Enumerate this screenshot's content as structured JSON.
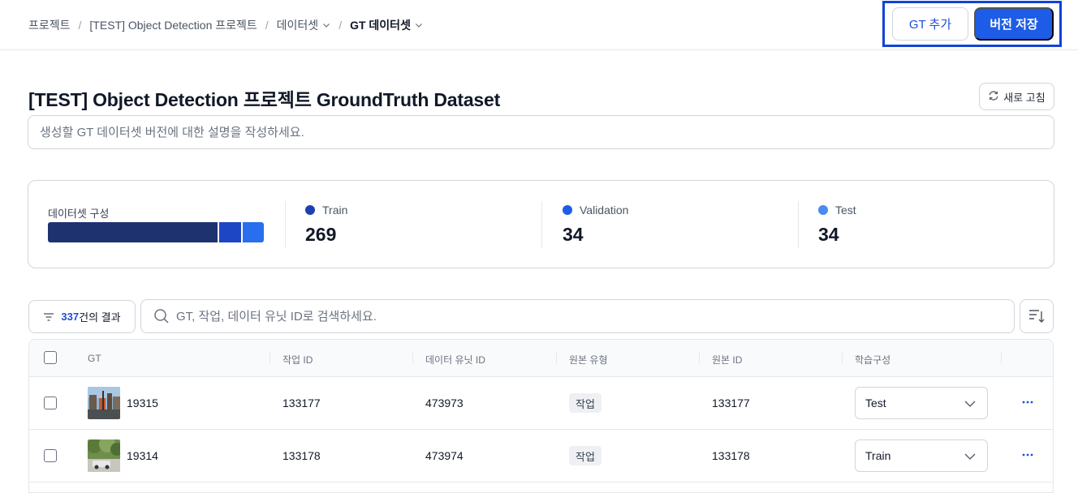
{
  "breadcrumb": {
    "items": [
      {
        "label": "프로젝트",
        "dropdown": false
      },
      {
        "label": "[TEST] Object Detection 프로젝트",
        "dropdown": false
      },
      {
        "label": "데이터셋",
        "dropdown": true
      },
      {
        "label": "GT 데이터셋",
        "dropdown": true
      }
    ],
    "separator": "/"
  },
  "actions": {
    "add_gt_label": "GT 추가",
    "save_version_label": "버전 저장"
  },
  "header": {
    "title": "[TEST] Object Detection 프로젝트 GroundTruth Dataset",
    "refresh_label": "새로 고침",
    "description_placeholder": "생성할 GT 데이터셋 버전에 대한 설명을 작성하세요."
  },
  "composition": {
    "label": "데이터셋 구성",
    "stats": [
      {
        "name": "Train",
        "value": "269",
        "color": "#1e3a8a"
      },
      {
        "name": "Validation",
        "value": "34",
        "color": "#1d4ed8"
      },
      {
        "name": "Test",
        "value": "34",
        "color": "#3b82f6"
      }
    ]
  },
  "filter": {
    "count": "337",
    "suffix": "건의 결과"
  },
  "search": {
    "placeholder": "GT, 작업, 데이터 유닛 ID로 검색하세요."
  },
  "table": {
    "columns": [
      "GT",
      "작업 ID",
      "데이터 유닛 ID",
      "원본 유형",
      "원본 ID",
      "학습구성"
    ],
    "rows": [
      {
        "gt_id": "19315",
        "task_id": "133177",
        "data_unit_id": "473973",
        "source_type": "작업",
        "source_id": "133177",
        "split": "Test",
        "thumb": "street-scene"
      },
      {
        "gt_id": "19314",
        "task_id": "133178",
        "data_unit_id": "473974",
        "source_type": "작업",
        "source_id": "133178",
        "split": "Train",
        "thumb": "tree-scene"
      }
    ]
  },
  "icons": {
    "chevron": "chevron-down-icon",
    "refresh": "refresh-icon",
    "filter": "filter-icon",
    "search": "search-icon",
    "sort": "sort-icon",
    "more": "more-horizontal-icon"
  },
  "colors": {
    "primary": "#1d5ce6",
    "highlight_border": "#1243d6"
  }
}
